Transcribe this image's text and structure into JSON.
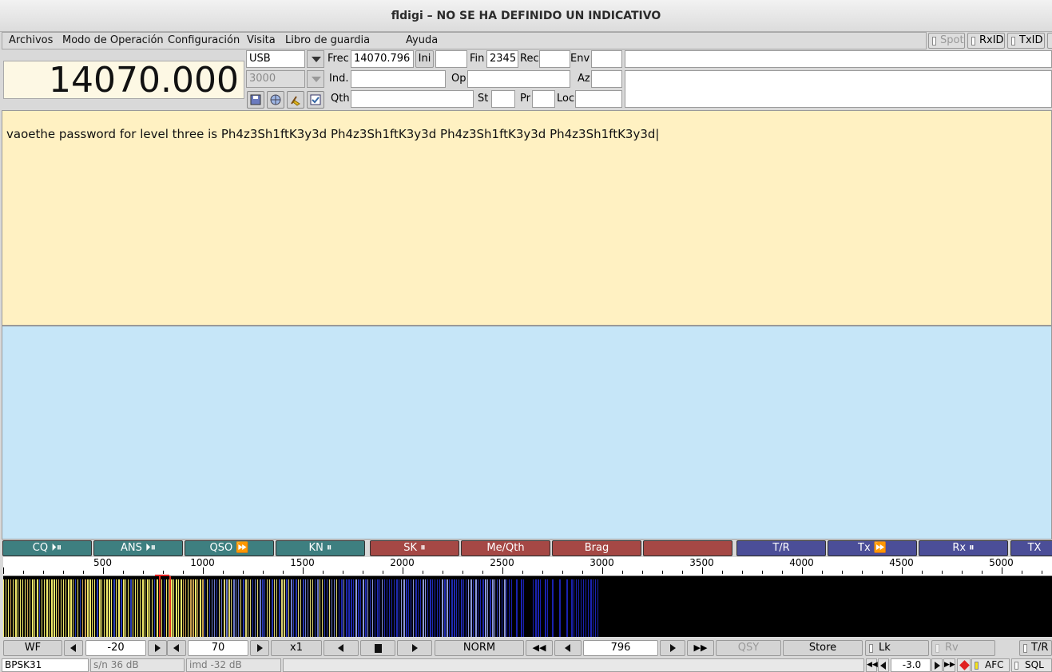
{
  "window": {
    "title": "fldigi – NO SE HA DEFINIDO UN INDICATIVO"
  },
  "menu": {
    "archivos": "Archivos",
    "modo": "Modo de Operación",
    "configuracion": "Configuración",
    "visita": "Visita",
    "libro": "Libro de guardia",
    "ayuda": "Ayuda"
  },
  "toggles": {
    "spot": "Spot",
    "rxid": "RxID",
    "txid": "TxID"
  },
  "rig": {
    "frequency": "14070.000",
    "mode": "USB",
    "bandwidth": "3000"
  },
  "log": {
    "frec_label": "Frec",
    "frec_value": "14070.796",
    "ini_button": "Ini",
    "ini_value": "",
    "fin_label": "Fin",
    "fin_value": "2345",
    "rec_label": "Rec",
    "rec_value": "",
    "env_label": "Env",
    "env_value": "",
    "ind_label": "Ind.",
    "ind_value": "",
    "op_label": "Op",
    "op_value": "",
    "az_label": "Az",
    "az_value": "",
    "qth_label": "Qth",
    "qth_value": "",
    "st_label": "St",
    "st_value": "",
    "pr_label": "Pr",
    "pr_value": "",
    "loc_label": "Loc",
    "loc_value": ""
  },
  "rx": {
    "text": "vaoethe password for level three is Ph4z3Sh1ftK3y3d Ph4z3Sh1ftK3y3d Ph4z3Sh1ftK3y3d Ph4z3Sh1ftK3y3d|"
  },
  "macros": [
    {
      "label": "CQ ⏵⏸",
      "color": "g"
    },
    {
      "label": "ANS ⏵⏸",
      "color": "g"
    },
    {
      "label": "QSO ⏩",
      "color": "g"
    },
    {
      "label": "KN ⏸",
      "color": "g"
    },
    {
      "label": "SK ⏸",
      "color": "r"
    },
    {
      "label": "Me/Qth",
      "color": "r"
    },
    {
      "label": "Brag",
      "color": "r"
    },
    {
      "label": "",
      "color": "r"
    },
    {
      "label": "T/R",
      "color": "b"
    },
    {
      "label": "Tx ⏩",
      "color": "b"
    },
    {
      "label": "Rx ⏸",
      "color": "b"
    },
    {
      "label": "TX",
      "color": "b"
    }
  ],
  "scale": {
    "labels": [
      "500",
      "1000",
      "1500",
      "2000",
      "2500",
      "3000",
      "3500",
      "4000",
      "4500",
      "5000"
    ]
  },
  "waterfall_controls": {
    "wf_button": "WF",
    "ref_level": "-20",
    "range": "70",
    "zoom": "x1",
    "mode": "NORM",
    "carrier": "796",
    "qsy": "QSY",
    "store": "Store",
    "lk": "Lk",
    "rv": "Rv",
    "tr": "T/R"
  },
  "status": {
    "mode": "BPSK31",
    "snr": "s/n 36 dB",
    "imd": "imd -32 dB",
    "afc_value": "-3.0",
    "afc": "AFC",
    "sql": "SQL"
  }
}
